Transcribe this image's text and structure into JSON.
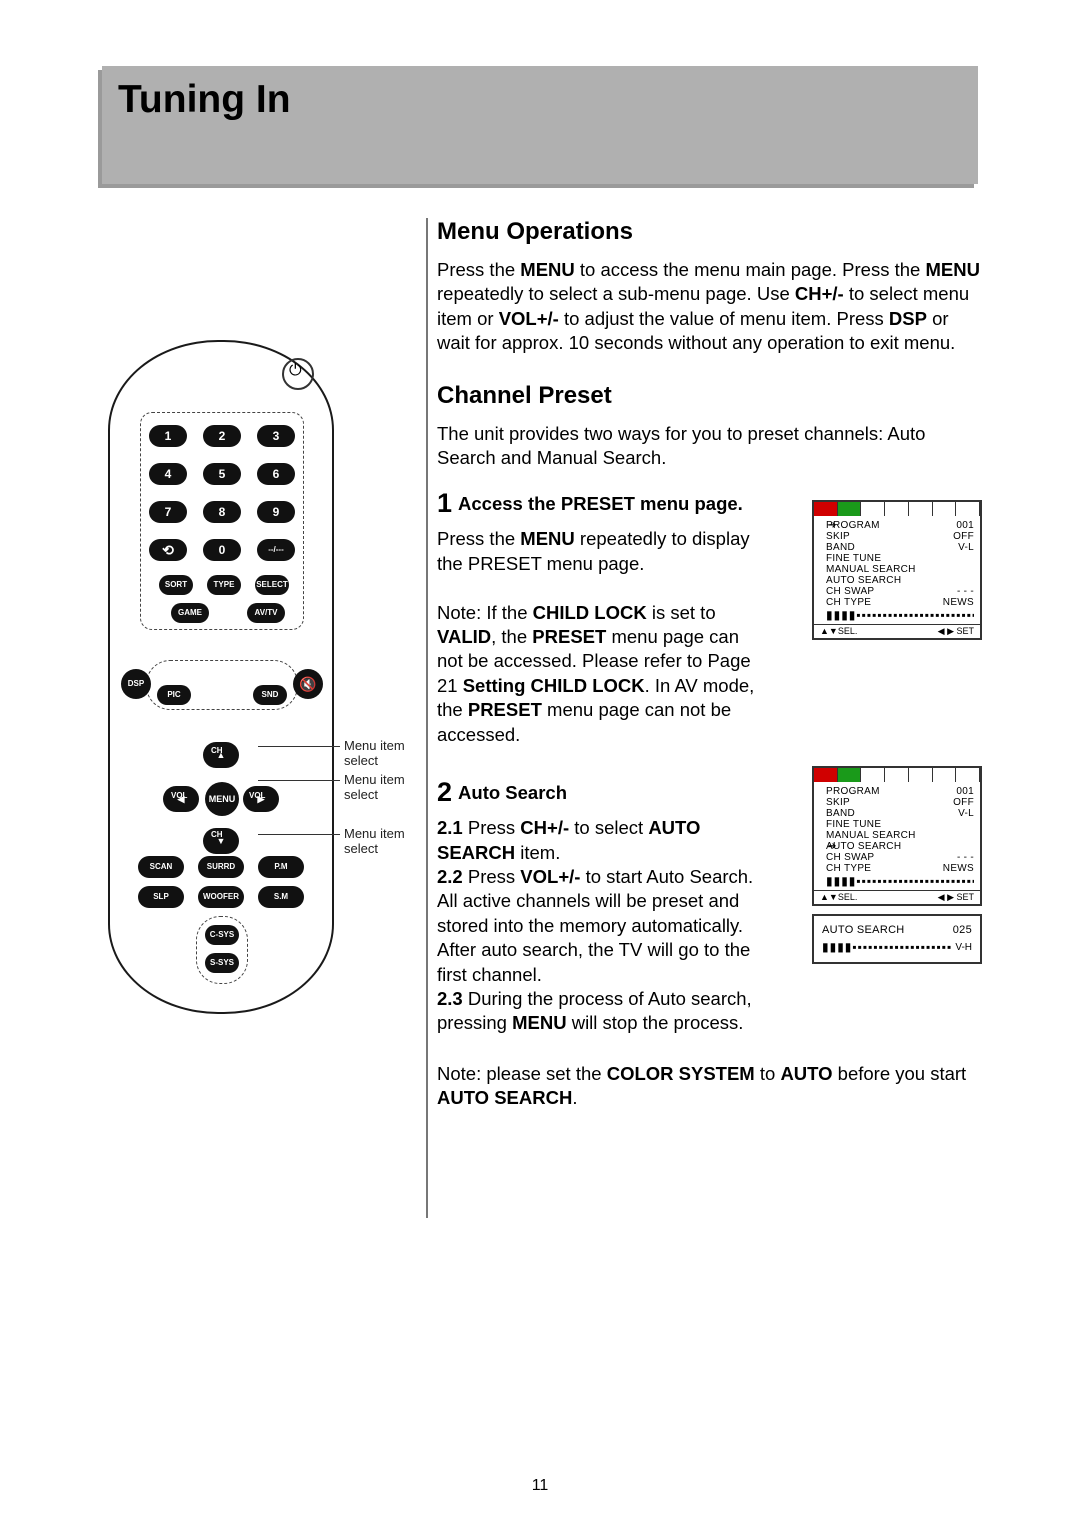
{
  "page_number": "11",
  "title": "Tuning In",
  "sections": {
    "menu_ops": {
      "heading": "Menu Operations",
      "p1a": "Press the ",
      "p1b": " to access the menu main page. Press the ",
      "p1c": " repeatedly to select a sub-menu page. Use ",
      "p1d": " to select menu item or ",
      "p1e": " to adjust the value of menu item. Press ",
      "p1f": " or wait for approx. 10 seconds without any operation to exit menu.",
      "menu": "MENU",
      "ch": "CH+/-",
      "vol": "VOL+/-",
      "dsp": "DSP"
    },
    "channel_preset": {
      "heading": "Channel Preset",
      "intro": "The unit provides two ways for you to preset channels: Auto Search and Manual Search.",
      "step1": {
        "num": "1",
        "heading": "Access the PRESET menu page.",
        "p1a": "Press the ",
        "p1b": " repeatedly to display the PRESET menu page.",
        "menu": "MENU",
        "note_a": "Note: If the ",
        "child_lock": "CHILD LOCK",
        "note_b": " is set to ",
        "valid": "VALID",
        "note_c": ", the ",
        "preset": "PRESET",
        "note_d": " menu page can not be accessed. Please refer to Page 21 ",
        "setting": "Setting CHILD LOCK",
        "note_e": ". In AV mode, the ",
        "note_f": " menu page can not be accessed."
      },
      "step2": {
        "num": "2",
        "heading": "Auto Search",
        "l21a": "2.1",
        "l21b": " Press ",
        "ch": "CH+/-",
        "l21c": " to select ",
        "auto_search": "AUTO SEARCH",
        "l21d": " item.",
        "l22a": "2.2",
        "l22b": " Press ",
        "vol": "VOL+/-",
        "l22c": " to start Auto Search. All active channels will be preset and stored into the memory automatically. After auto search, the TV will go to the first channel.",
        "l23a": "2.3",
        "l23b": " During the process of Auto search, pressing ",
        "menu": "MENU",
        "l23c": " will stop the process.",
        "note_a": "Note: please set the ",
        "color_sys": "COLOR SYSTEM",
        "note_b": " to ",
        "auto": "AUTO",
        "note_c": " before you start ",
        "note_d": "."
      }
    }
  },
  "remote": {
    "nums": [
      "1",
      "2",
      "3",
      "4",
      "5",
      "6",
      "7",
      "8",
      "9",
      "⟲",
      "0",
      "--/---"
    ],
    "row3": [
      "SORT",
      "TYPE",
      "SELECT"
    ],
    "row4": [
      "GAME",
      "AV/TV"
    ],
    "side_left": "DSP",
    "side_right": "🔇",
    "pic": "PIC",
    "snd": "SND",
    "ch_up": "CH",
    "ch_dn": "CH",
    "vol_l": "VOL",
    "vol_r": "VOL",
    "menu": "MENU",
    "lower": [
      [
        "SCAN",
        "SURRD",
        "P.M"
      ],
      [
        "SLP",
        "WOOFER",
        "S.M"
      ]
    ],
    "csys": "C-SYS",
    "ssys": "S-SYS",
    "callouts": [
      "Menu item select",
      "Menu item select",
      "Menu item select"
    ]
  },
  "osd": {
    "rows": [
      {
        "l": "PROGRAM",
        "r": "001"
      },
      {
        "l": "SKIP",
        "r": "OFF"
      },
      {
        "l": "BAND",
        "r": "V-L"
      },
      {
        "l": "FINE TUNE",
        "r": ""
      },
      {
        "l": "MANUAL SEARCH",
        "r": ""
      },
      {
        "l": "AUTO SEARCH",
        "r": ""
      },
      {
        "l": "CH SWAP",
        "r": "- - -"
      },
      {
        "l": "CH TYPE",
        "r": "NEWS"
      }
    ],
    "footer_l": "▲▼SEL.",
    "footer_r": "◀ ▶ SET",
    "tab_colors": [
      "#d00000",
      "#1a9a1a",
      "#888",
      "#888",
      "#888",
      "#888",
      "#888"
    ],
    "bar_dots": "▮▮▮▮▪▪▪▪▪▪▪▪▪▪▪▪▪▪▪▪▪▪▪▪▪▪▪▪▪▪▪▪",
    "search_label": "AUTO SEARCH",
    "search_val": "025",
    "search_band": "V-H"
  }
}
